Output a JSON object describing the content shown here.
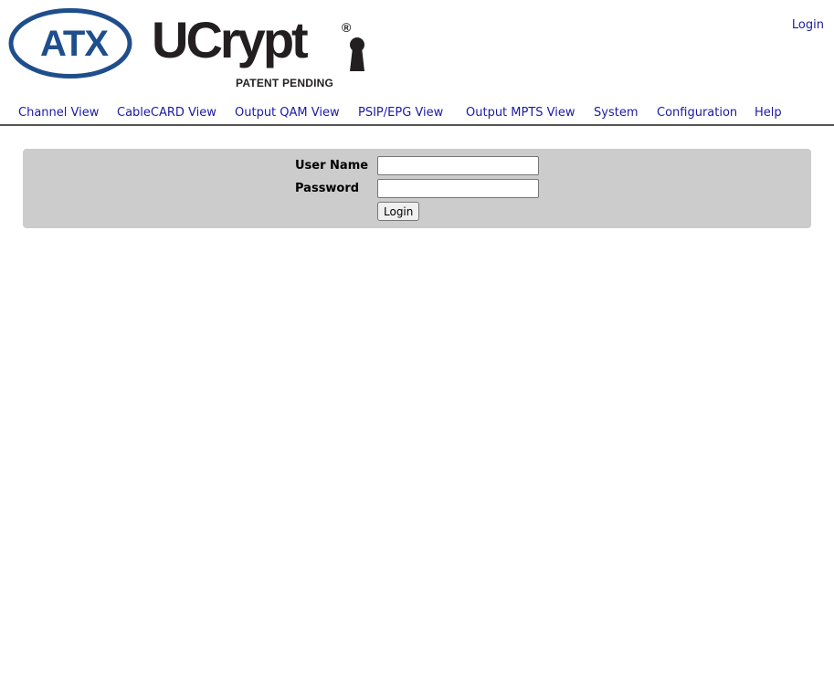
{
  "header": {
    "atx_logo_text": "ATX",
    "ucrypt_logo_text": "UCrypt",
    "registered_mark": "®",
    "patent_text": "PATENT PENDING",
    "login_link": "Login"
  },
  "nav": {
    "items": [
      {
        "label": "Channel View"
      },
      {
        "label": "CableCARD View"
      },
      {
        "label": "Output QAM View"
      },
      {
        "label": "PSIP/EPG View"
      },
      {
        "label": "Output MPTS View"
      },
      {
        "label": "System"
      },
      {
        "label": "Configuration"
      },
      {
        "label": "Help"
      }
    ]
  },
  "login_form": {
    "username_label": "User Name",
    "username_value": "",
    "password_label": "Password",
    "password_value": "",
    "submit_label": "Login"
  },
  "colors": {
    "link": "#1a1aa6",
    "panel_bg": "#cccccc",
    "atx_blue": "#1f4e8c",
    "logo_dark": "#231f20"
  }
}
